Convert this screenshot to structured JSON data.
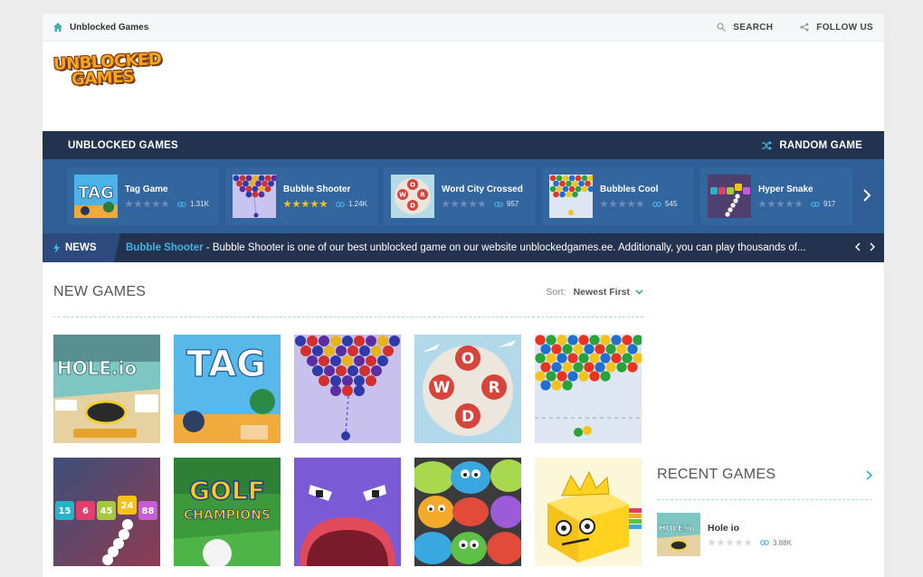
{
  "topbar": {
    "site_name": "Unblocked Games",
    "search_label": "SEARCH",
    "follow_label": "FOLLOW US"
  },
  "logo": {
    "line1": "UNBLOCKED",
    "line2": "GAMES"
  },
  "featured": {
    "heading": "UNBLOCKED GAMES",
    "random_label": "RANDOM GAME",
    "cards": [
      {
        "title": "Tag Game",
        "stars": 0,
        "views": "1.31K"
      },
      {
        "title": "Bubble Shooter",
        "stars": 5,
        "views": "1.24K"
      },
      {
        "title": "Word City Crossed",
        "stars": 0,
        "views": "957"
      },
      {
        "title": "Bubbles Cool",
        "stars": 0,
        "views": "545"
      },
      {
        "title": "Hyper Snake",
        "stars": 0,
        "views": "917"
      }
    ]
  },
  "news": {
    "label": "NEWS",
    "highlight": "Bubble Shooter",
    "text": " - Bubble Shooter is one of our best unblocked game on our website unblockedgames.ee. Additionally, you can play thousands of..."
  },
  "new_games": {
    "title": "NEW GAMES",
    "sort_label": "Sort:",
    "sort_value": "Newest First",
    "tiles": [
      {
        "name": "hole-io",
        "text": "HOLE.io"
      },
      {
        "name": "tag",
        "text": "TAG"
      },
      {
        "name": "bubble-shooter",
        "text": ""
      },
      {
        "name": "word-city-crossed",
        "text": "WORD"
      },
      {
        "name": "bubbles-cool",
        "text": ""
      },
      {
        "name": "hyper-snake",
        "numbers": [
          "15",
          "6",
          "45",
          "24",
          "88"
        ]
      },
      {
        "name": "golf-champions",
        "text1": "GOLF",
        "text2": "CHAMPIONS"
      },
      {
        "name": "purple-monster",
        "text": ""
      },
      {
        "name": "jelly-faces",
        "text": ""
      },
      {
        "name": "king-cube",
        "text": ""
      }
    ]
  },
  "recent_games": {
    "title": "RECENT GAMES",
    "items": [
      {
        "title": "Hole io",
        "views": "3.88K"
      }
    ]
  },
  "colors": {
    "accent": "#43b5e6",
    "dark_header": "#23324f",
    "carousel_bg": "#2f5d96",
    "star_on": "#f5c518"
  }
}
